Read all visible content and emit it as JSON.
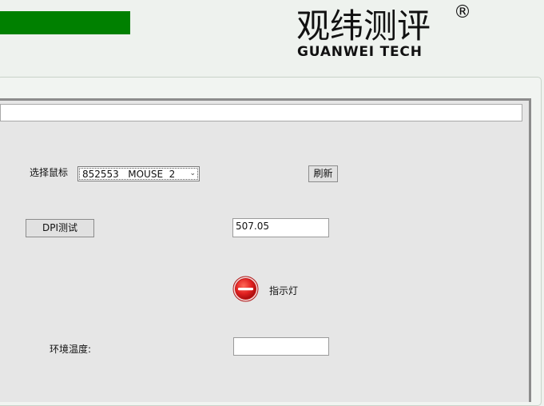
{
  "logo": {
    "chinese": "观纬测评",
    "registered": "®",
    "english": "GUANWEI TECH"
  },
  "colors": {
    "header_bar": "#008000",
    "panel_bg": "#e6e6e6",
    "indicator": "#e02020"
  },
  "form": {
    "mouse_label": "选择鼠标",
    "mouse_selected": "852553   MOUSE  2",
    "refresh_button": "刷新",
    "dpi_button": "DPI测试",
    "dpi_value": "507.05",
    "indicator_label": "指示灯",
    "indicator_icon": "red-stop-indicator-icon",
    "temperature_label": "环境温度:",
    "temperature_value": ""
  }
}
